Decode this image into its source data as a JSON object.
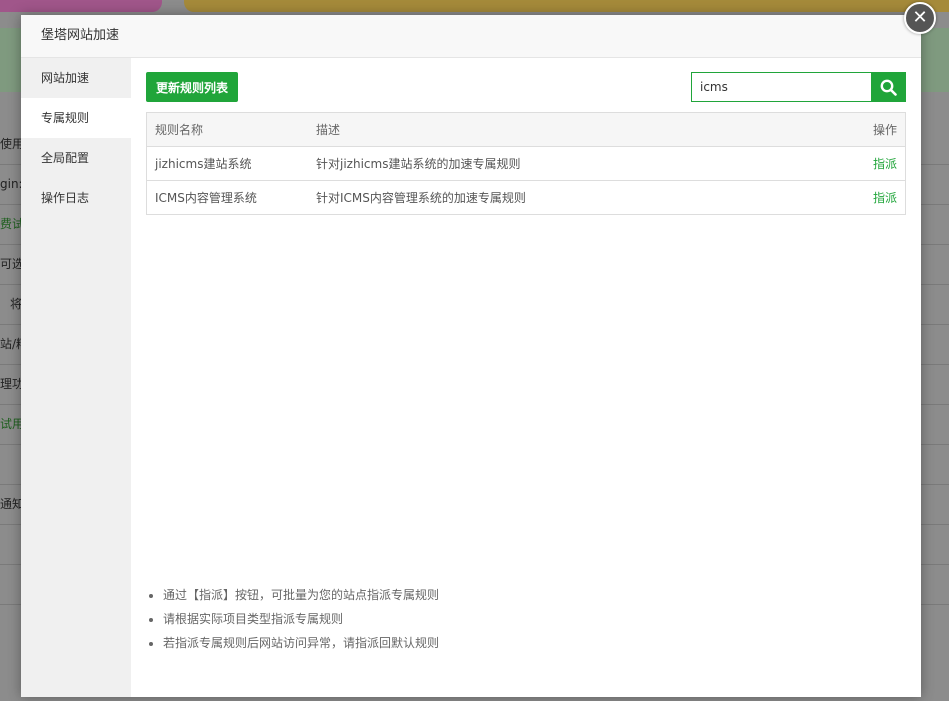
{
  "background": {
    "left_rows": [
      {
        "text": "使用",
        "green": false
      },
      {
        "text": "gin:",
        "green": false
      },
      {
        "text": "费试",
        "green": true
      },
      {
        "text": "可选",
        "green": false
      },
      {
        "text": "将",
        "green": false
      },
      {
        "text": "站/精",
        "green": false
      },
      {
        "text": "理功",
        "green": false
      },
      {
        "text": "试用",
        "green": true
      },
      {
        "text": "",
        "green": false
      },
      {
        "text": "通知",
        "green": false
      },
      {
        "text": "",
        "green": false
      },
      {
        "text": "",
        "green": false
      }
    ]
  },
  "modal": {
    "title": "堡塔网站加速",
    "close_label": "✕"
  },
  "sidebar": {
    "items": [
      {
        "label": "网站加速",
        "active": false
      },
      {
        "label": "专属规则",
        "active": true
      },
      {
        "label": "全局配置",
        "active": false
      },
      {
        "label": "操作日志",
        "active": false
      }
    ]
  },
  "toolbar": {
    "update_label": "更新规则列表",
    "search_value": "icms",
    "search_icon": "search-icon"
  },
  "table": {
    "headers": {
      "name": "规则名称",
      "desc": "描述",
      "op": "操作"
    },
    "rows": [
      {
        "name": "jizhicms建站系统",
        "desc": "针对jizhicms建站系统的加速专属规则",
        "op": "指派"
      },
      {
        "name": "ICMS内容管理系统",
        "desc": "针对ICMS内容管理系统的加速专属规则",
        "op": "指派"
      }
    ]
  },
  "tips": [
    "通过【指派】按钮，可批量为您的站点指派专属规则",
    "请根据实际项目类型指派专属规则",
    "若指派专属规则后网站访问异常，请指派回默认规则"
  ],
  "colors": {
    "accent": "#20a53a"
  }
}
